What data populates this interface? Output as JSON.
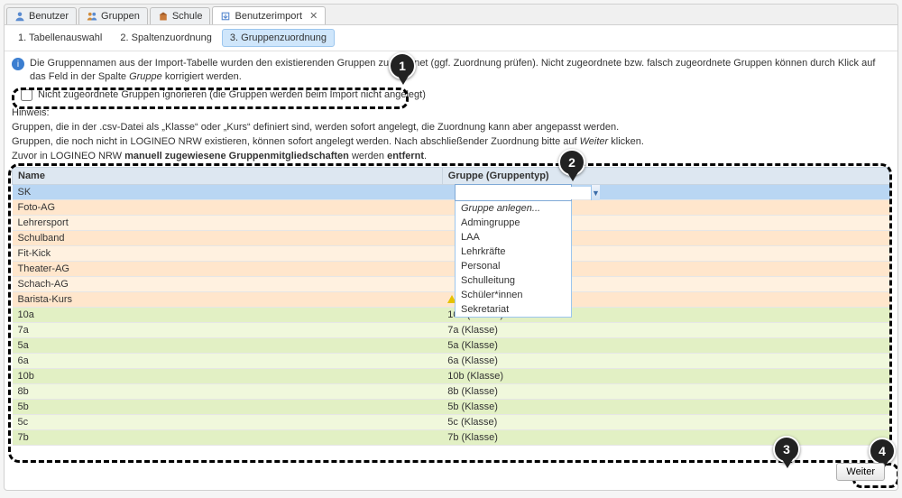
{
  "moduleTabs": [
    {
      "label": "Benutzer",
      "icon": "user-icon"
    },
    {
      "label": "Gruppen",
      "icon": "group-icon"
    },
    {
      "label": "Schule",
      "icon": "school-icon"
    },
    {
      "label": "Benutzerimport",
      "icon": "import-icon",
      "closable": true,
      "active": true
    }
  ],
  "stepTabs": [
    {
      "label": "1. Tabellenauswahl"
    },
    {
      "label": "2. Spaltenzuordnung"
    },
    {
      "label": "3. Gruppenzuordnung",
      "active": true
    }
  ],
  "info": {
    "pre": "Die Gruppennamen aus der Import-Tabelle wurden den existierenden Gruppen zugeordnet (ggf. Zuordnung prüfen). Nicht zugeordnete bzw. falsch zugeordnete Gruppen können durch Klick auf das Feld in der Spalte ",
    "italic": "Gruppe",
    "post": " korrigiert werden."
  },
  "checkbox": {
    "label": "Nicht zugeordnete Gruppen ignorieren (die Gruppen werden beim Import nicht angelegt)",
    "checked": false
  },
  "hints": {
    "title": "Hinweis:",
    "line1": "Gruppen, die in der .csv-Datei als „Klasse“ oder „Kurs“ definiert sind, werden sofort angelegt, die Zuordnung kann aber angepasst werden.",
    "line2_pre": "Gruppen, die noch nicht in LOGINEO NRW existieren, können sofort angelegt werden. Nach abschließender Zuordnung bitte auf ",
    "line2_weiter": "Weiter",
    "line2_post": " klicken.",
    "line3_pre": "Zuvor in LOGINEO NRW ",
    "line3_bold1": "manuell zugewiesene Gruppenmitgliedschaften",
    "line3_mid": " werden ",
    "line3_bold2": "entfernt",
    "line3_post": "."
  },
  "grid": {
    "headers": {
      "name": "Name",
      "group": "Gruppe (Gruppentyp)"
    },
    "rows": [
      {
        "name": "SK",
        "group": "",
        "state": "selected"
      },
      {
        "name": "Foto-AG",
        "group": "",
        "state": "orange"
      },
      {
        "name": "Lehrersport",
        "group": "",
        "state": "orange"
      },
      {
        "name": "Schulband",
        "group": "",
        "state": "orange"
      },
      {
        "name": "Fit-Kick",
        "group": "",
        "state": "orange"
      },
      {
        "name": "Theater-AG",
        "group": "",
        "state": "orange"
      },
      {
        "name": "Schach-AG",
        "group": "",
        "state": "orange"
      },
      {
        "name": "Barista-Kurs",
        "group": "",
        "state": "orange",
        "warn": true
      },
      {
        "name": "10a",
        "group": "10a (Klasse)",
        "state": "green"
      },
      {
        "name": "7a",
        "group": "7a (Klasse)",
        "state": "green"
      },
      {
        "name": "5a",
        "group": "5a (Klasse)",
        "state": "green"
      },
      {
        "name": "6a",
        "group": "6a (Klasse)",
        "state": "green"
      },
      {
        "name": "10b",
        "group": "10b (Klasse)",
        "state": "green"
      },
      {
        "name": "8b",
        "group": "8b (Klasse)",
        "state": "green"
      },
      {
        "name": "5b",
        "group": "5b (Klasse)",
        "state": "green"
      },
      {
        "name": "5c",
        "group": "5c (Klasse)",
        "state": "green"
      },
      {
        "name": "7b",
        "group": "7b (Klasse)",
        "state": "green"
      }
    ]
  },
  "combo": {
    "value": "",
    "options": [
      {
        "label": "Gruppe anlegen...",
        "italic": true
      },
      {
        "label": "Admingruppe"
      },
      {
        "label": "LAA"
      },
      {
        "label": "Lehrkräfte"
      },
      {
        "label": "Personal"
      },
      {
        "label": "Schulleitung"
      },
      {
        "label": "Schüler*innen"
      },
      {
        "label": "Sekretariat"
      }
    ]
  },
  "buttons": {
    "next": "Weiter"
  },
  "markers": {
    "m1": "1",
    "m2": "2",
    "m3": "3",
    "m4": "4"
  }
}
